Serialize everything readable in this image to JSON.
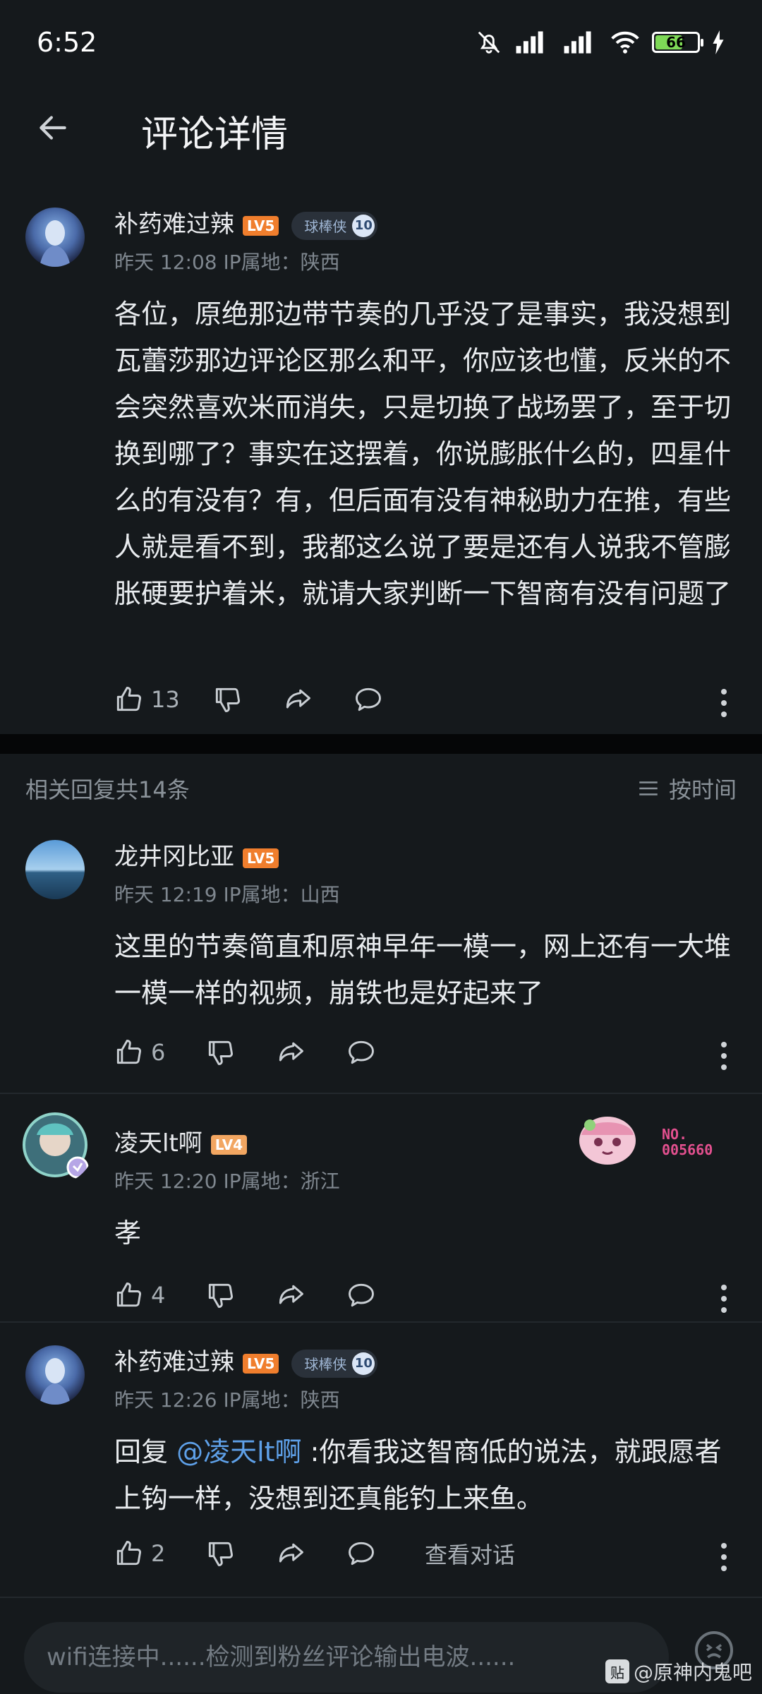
{
  "status_bar": {
    "time": "6:52",
    "battery": "66"
  },
  "header": {
    "title": "评论详情"
  },
  "main_post": {
    "author": "补药难过辣",
    "level": "LV5",
    "badge_label": "球棒侠",
    "badge_num": "10",
    "time": "昨天 12:08",
    "ip": "IP属地：陕西",
    "content": "各位，原绝那边带节奏的几乎没了是事实，我没想到瓦蕾莎那边评论区那么和平，你应该也懂，反米的不会突然喜欢米而消失，只是切换了战场罢了，至于切换到哪了？事实在这摆着，你说膨胀什么的，四星什么的有没有？有，但后面有没有神秘助力在推，有些人就是看不到，我都这么说了要是还有人说我不管膨胀硬要护着米，就请大家判断一下智商有没有问题了",
    "likes": "13"
  },
  "replies_header": {
    "title": "相关回复共14条",
    "sort_label": "按时间"
  },
  "replies": [
    {
      "author": "龙井冈比亚",
      "level": "LV5",
      "time": "昨天 12:19",
      "ip": "IP属地：山西",
      "content": "这里的节奏简直和原神早年一模一，网上还有一大堆一模一样的视频，崩铁也是好起来了",
      "likes": "6"
    },
    {
      "author": "凌天lt啊",
      "level": "LV4",
      "time": "昨天 12:20",
      "ip": "IP属地：浙江",
      "content": "孝",
      "likes": "4",
      "pendant_no": "NO.",
      "pendant_num": "005660"
    },
    {
      "author": "补药难过辣",
      "level": "LV5",
      "badge_label": "球棒侠",
      "badge_num": "10",
      "time": "昨天 12:26",
      "ip": "IP属地：陕西",
      "reply_prefix": "回复 ",
      "mention": "@凌天lt啊",
      "content": " :你看我这智商低的说法，就跟愿者上钩一样，没想到还真能钓上来鱼。",
      "likes": "2",
      "view_conversation": "查看对话"
    }
  ],
  "input": {
    "placeholder": "wifi连接中......检测到粉丝评论输出电波......"
  },
  "watermark": {
    "logo": "贴",
    "text": "@原神内鬼吧"
  }
}
